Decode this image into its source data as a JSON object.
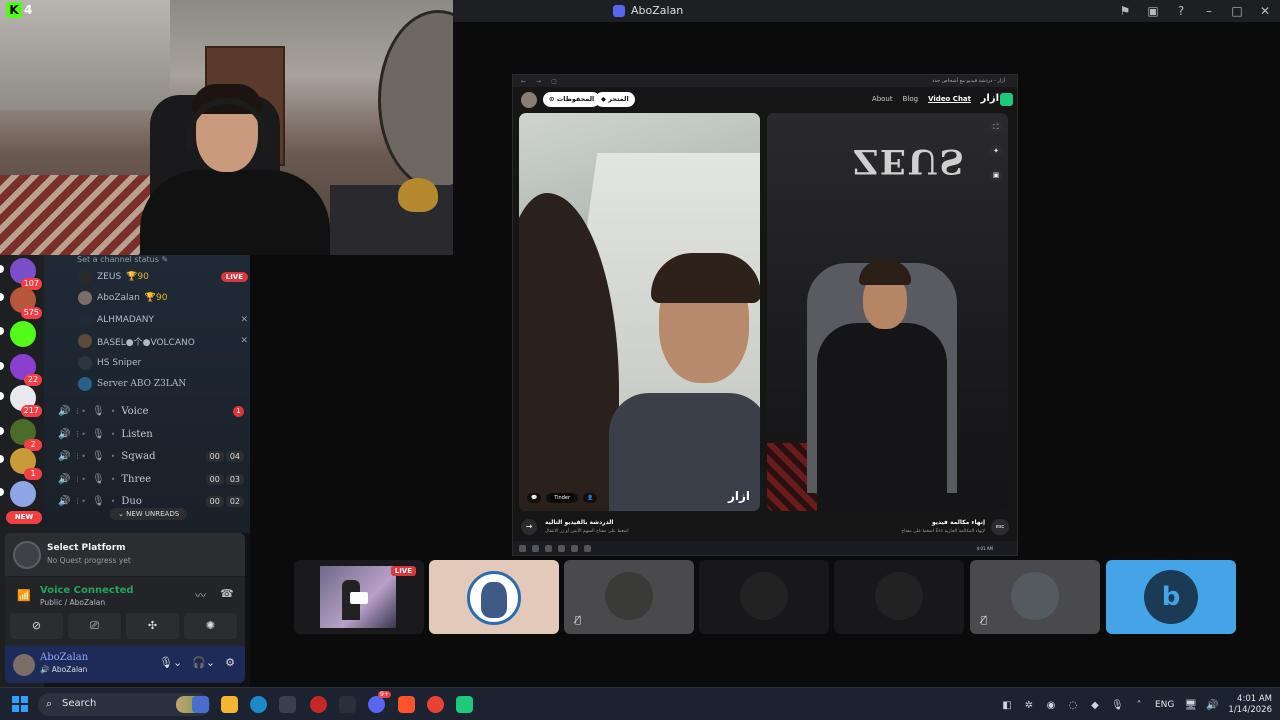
{
  "window": {
    "title": "AboZalan"
  },
  "stream_overlay": {
    "platform_count": "4"
  },
  "servers": [
    {
      "badge": "107",
      "color": "#7b4fc9"
    },
    {
      "badge": "575",
      "color": "#b5573a"
    },
    {
      "badge": "",
      "color": "#53fc18"
    },
    {
      "badge": "22",
      "color": "#8a3fd1"
    },
    {
      "badge": "217",
      "color": "#e8e8ef"
    },
    {
      "badge": "2",
      "color": "#4a6b2a"
    },
    {
      "badge": "1",
      "color": "#c99a3a"
    },
    {
      "badge": "",
      "color": "#8ea6e6"
    }
  ],
  "rail": {
    "new_label": "NEW"
  },
  "channel_status_hint": "Set a channel status",
  "voice_users": [
    {
      "name": "ZEUS",
      "extra": "🏆90",
      "live": "LIVE"
    },
    {
      "name": "AboZalan",
      "extra": "🏆90"
    },
    {
      "name": "ALHMADANY",
      "muted": "✕"
    },
    {
      "name": "BASEL●个●VOLCANO",
      "muted": "✕"
    },
    {
      "name": "HS Sniper"
    },
    {
      "name": "Server ABO Z3LAN"
    }
  ],
  "voice_channels": [
    {
      "name": "Voice",
      "ping": "1"
    },
    {
      "name": "Listen"
    },
    {
      "name": "Sqwad",
      "count": [
        "00",
        "04"
      ]
    },
    {
      "name": "Three",
      "count": [
        "00",
        "03"
      ]
    },
    {
      "name": "Duo",
      "count": [
        "00",
        "02"
      ]
    }
  ],
  "new_unreads": "NEW UNREADS",
  "quest": {
    "title": "Select Platform",
    "subtitle": "No Quest progress yet"
  },
  "voice_connected": {
    "title": "Voice Connected",
    "subtitle": "Public / AboZalan"
  },
  "user": {
    "name": "AboZalan",
    "status": "AboZalan"
  },
  "shared_screen": {
    "tab_url": "أزار - دردشة فيديو مع أشخاص جدد",
    "pill_saved": "المحفوظات",
    "pill_store": "المتجر",
    "nav_links": [
      "About",
      "Blog",
      "Video Chat"
    ],
    "brand": "ازار",
    "watermark": "ازار",
    "chip_tinder": "Tinder",
    "bottom_left_title": "الدردشة بالفيديو التالية",
    "bottom_left_sub": "اضغط على مفتاح السهم الأيمن أو زر الانتقال",
    "bottom_right_title": "إنهاء مكالمة فيديو",
    "bottom_right_sub": "اضغط على مفتاح Esc لإنهاء المكالمة الجارية",
    "esc": "esc",
    "clock": "4:01 AM",
    "zeus_text": "ZEUS"
  },
  "tiles": [
    {
      "type": "stream",
      "live": "LIVE"
    },
    {
      "type": "avatar"
    },
    {
      "type": "avatar",
      "muted": true
    },
    {
      "type": "avatar"
    },
    {
      "type": "avatar"
    },
    {
      "type": "avatar",
      "muted": true
    },
    {
      "type": "logo"
    }
  ],
  "taskbar": {
    "search_placeholder": "Search",
    "discord_badge": "9+",
    "lang": "ENG",
    "time": "4:01 AM",
    "date": "1/14/2026"
  },
  "colors": {
    "accent": "#5865f2",
    "live": "#da373c",
    "voice_green": "#23a55a",
    "tile_blue": "#45a4e6"
  }
}
